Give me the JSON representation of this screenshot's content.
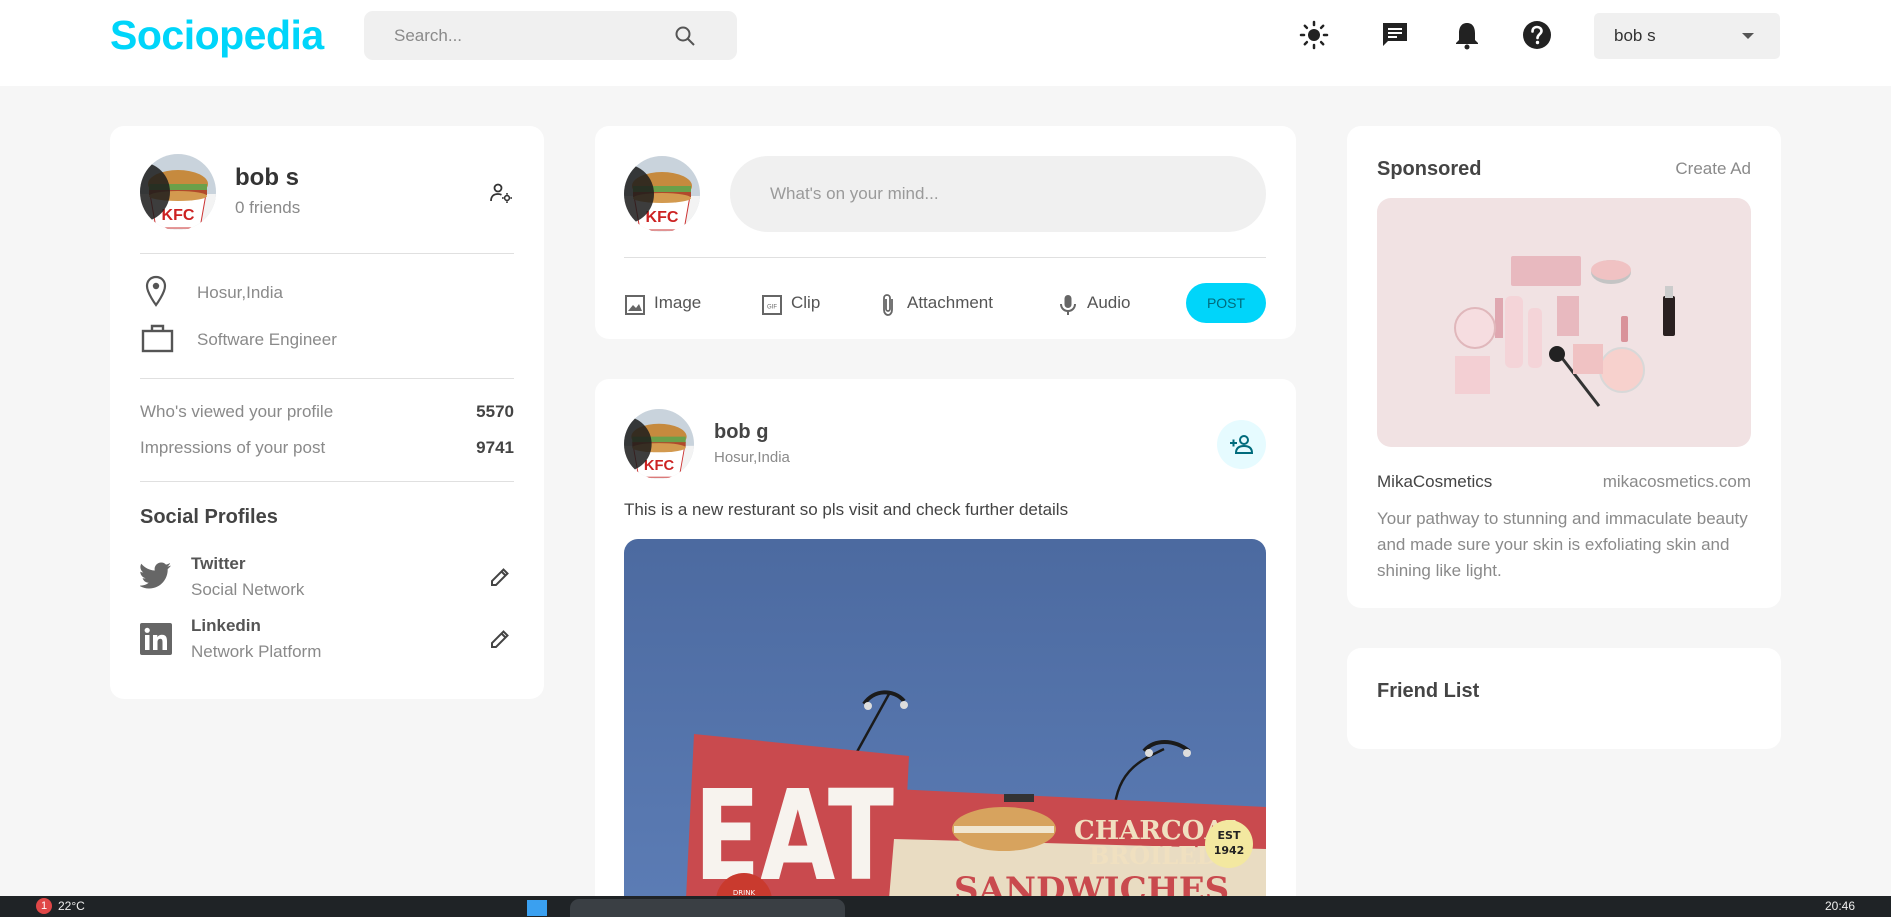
{
  "nav": {
    "logo": "Sociopedia",
    "search_placeholder": "Search...",
    "user_selected": "bob s",
    "icons": [
      "sun-icon",
      "message-icon",
      "bell-icon",
      "help-icon"
    ]
  },
  "profile": {
    "name": "bob s",
    "friends": "0 friends",
    "location": "Hosur,India",
    "occupation": "Software Engineer",
    "stats": [
      {
        "label": "Who's viewed your profile",
        "value": "5570"
      },
      {
        "label": "Impressions of your post",
        "value": "9741"
      }
    ],
    "social_title": "Social Profiles",
    "social": [
      {
        "name": "Twitter",
        "desc": "Social Network"
      },
      {
        "name": "Linkedin",
        "desc": "Network Platform"
      }
    ]
  },
  "composer": {
    "placeholder": "What's on your mind...",
    "actions": [
      "Image",
      "Clip",
      "Attachment",
      "Audio"
    ],
    "post_label": "POST"
  },
  "post": {
    "author": "bob g",
    "location": "Hosur,India",
    "text": "This is a new resturant so pls visit and check further details",
    "image_text": {
      "eat": "EAT",
      "charcoal": "CHARCOAL",
      "broiled": "BROILED",
      "est": "EST",
      "year": "1942",
      "drink": "DRINK",
      "sandwiches": "SANDWICHES"
    }
  },
  "sponsored": {
    "title": "Sponsored",
    "create_ad": "Create Ad",
    "brand": "MikaCosmetics",
    "url": "mikacosmetics.com",
    "desc": "Your pathway to stunning and immaculate beauty and made sure your skin is exfoliating skin and shining like light."
  },
  "friends": {
    "title": "Friend List"
  },
  "taskbar": {
    "weather": "22°C",
    "badge": "1",
    "time": "20:46"
  },
  "colors": {
    "accent": "#00d5fa",
    "background": "#f6f6f6",
    "card": "#ffffff"
  }
}
